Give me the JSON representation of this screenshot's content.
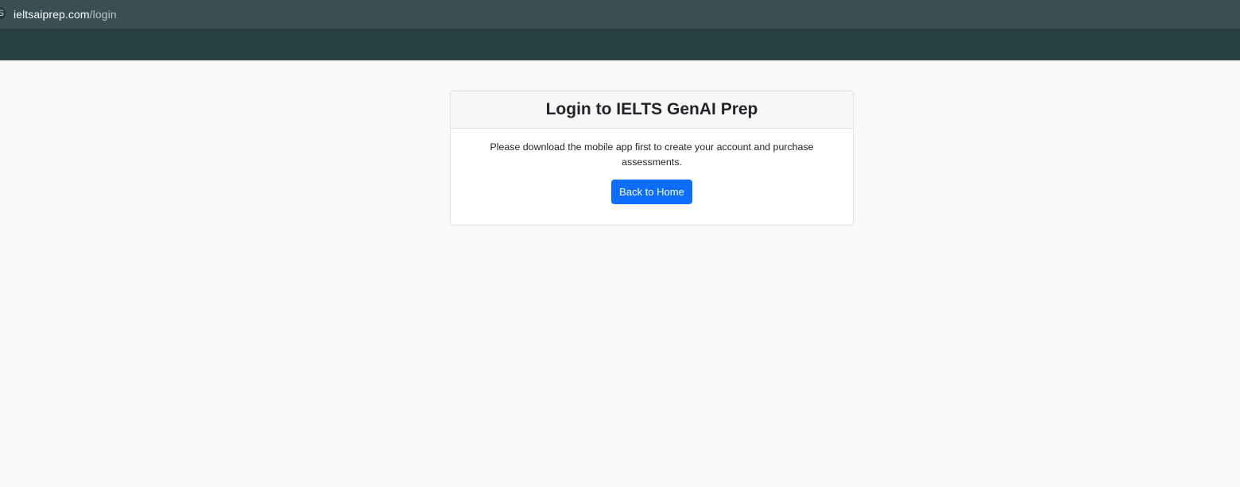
{
  "browser": {
    "url_domain": "ieltsaiprep.com",
    "url_path": "/login",
    "site_icon": "S"
  },
  "card": {
    "title": "Login to IELTS GenAI Prep",
    "message": "Please download the mobile app first to create your account and purchase assessments.",
    "button_label": "Back to Home"
  },
  "colors": {
    "address_bar": "#3a4e54",
    "bookmark_bar": "#283f44",
    "page_background": "#f8f9fa",
    "button_primary": "#0d6efd"
  }
}
